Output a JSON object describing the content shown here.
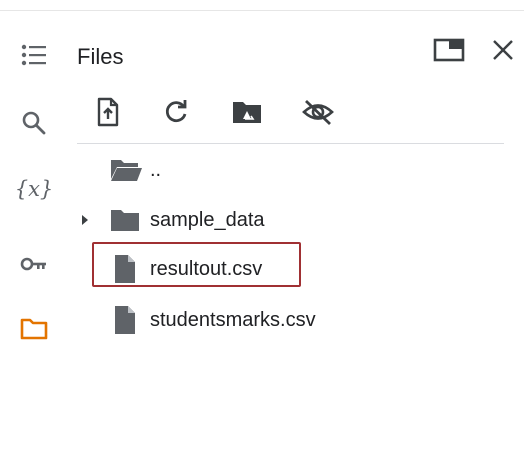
{
  "panel": {
    "title": "Files",
    "colors": {
      "accent_folder": "#e37400",
      "highlight_border": "#a03033"
    }
  },
  "rail": {
    "items": [
      {
        "name": "table-of-contents",
        "icon": "list-icon"
      },
      {
        "name": "find",
        "icon": "search-icon"
      },
      {
        "name": "variables",
        "icon": "variables-icon",
        "glyph": "{x}"
      },
      {
        "name": "secrets",
        "icon": "key-icon"
      },
      {
        "name": "files",
        "icon": "folder-outline-icon",
        "active": true
      }
    ]
  },
  "header": {
    "buttons": [
      {
        "name": "move-to-tab",
        "icon": "window-icon"
      },
      {
        "name": "close",
        "icon": "close-icon"
      }
    ]
  },
  "toolbar": {
    "buttons": [
      {
        "name": "upload",
        "icon": "upload-file-icon"
      },
      {
        "name": "refresh",
        "icon": "refresh-icon"
      },
      {
        "name": "mount-drive",
        "icon": "drive-folder-icon"
      },
      {
        "name": "toggle-hidden",
        "icon": "eye-off-icon"
      }
    ]
  },
  "tree": {
    "items": [
      {
        "label": "..",
        "type": "parent-folder",
        "icon": "folder-open-icon"
      },
      {
        "label": "sample_data",
        "type": "folder",
        "icon": "folder-icon",
        "expandable": true
      },
      {
        "label": "resultout.csv",
        "type": "file",
        "icon": "file-icon",
        "highlighted": true
      },
      {
        "label": "studentsmarks.csv",
        "type": "file",
        "icon": "file-icon"
      }
    ]
  }
}
